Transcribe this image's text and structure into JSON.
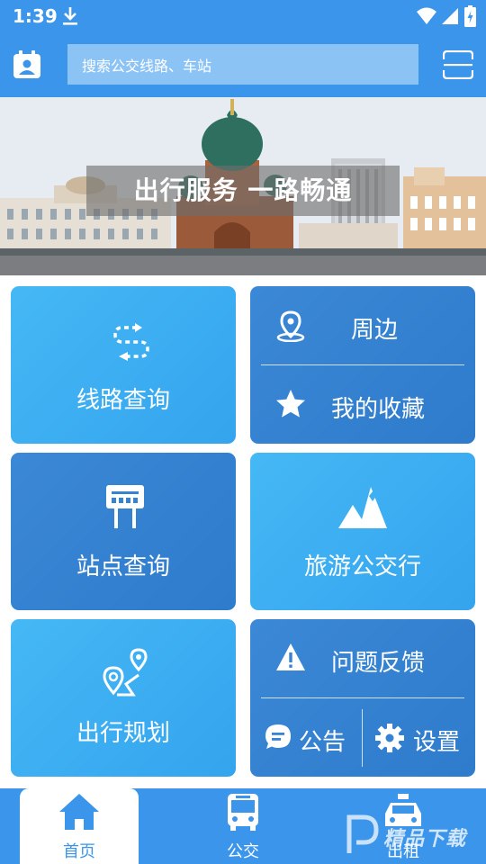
{
  "status_bar": {
    "time": "1:39"
  },
  "search": {
    "placeholder": "搜索公交线路、车站"
  },
  "banner": {
    "caption": "出行服务 一路畅通"
  },
  "cards": {
    "route_query": "线路查询",
    "nearby": "周边",
    "favorites": "我的收藏",
    "station_query": "站点查询",
    "tourism_bus": "旅游公交行",
    "trip_planning": "出行规划",
    "feedback": "问题反馈",
    "notice": "公告",
    "settings": "设置"
  },
  "bottom_nav": {
    "items": [
      {
        "label": "首页",
        "active": true
      },
      {
        "label": "公交",
        "active": false
      },
      {
        "label": "出租",
        "active": false
      }
    ]
  },
  "watermark": {
    "text": "精品下载"
  },
  "colors": {
    "primary": "#3b95ea",
    "card_light": "#3eaff2",
    "card_dark": "#3583d2"
  },
  "icons": [
    "download-icon",
    "wifi-icon",
    "signal-icon",
    "battery-icon",
    "calendar-icon",
    "scan-icon",
    "route-icon",
    "location-pin-icon",
    "star-icon",
    "bus-stop-sign-icon",
    "mountain-icon",
    "trip-route-icon",
    "warning-icon",
    "chat-bubble-icon",
    "gear-icon",
    "home-icon",
    "bus-icon",
    "taxi-icon"
  ]
}
